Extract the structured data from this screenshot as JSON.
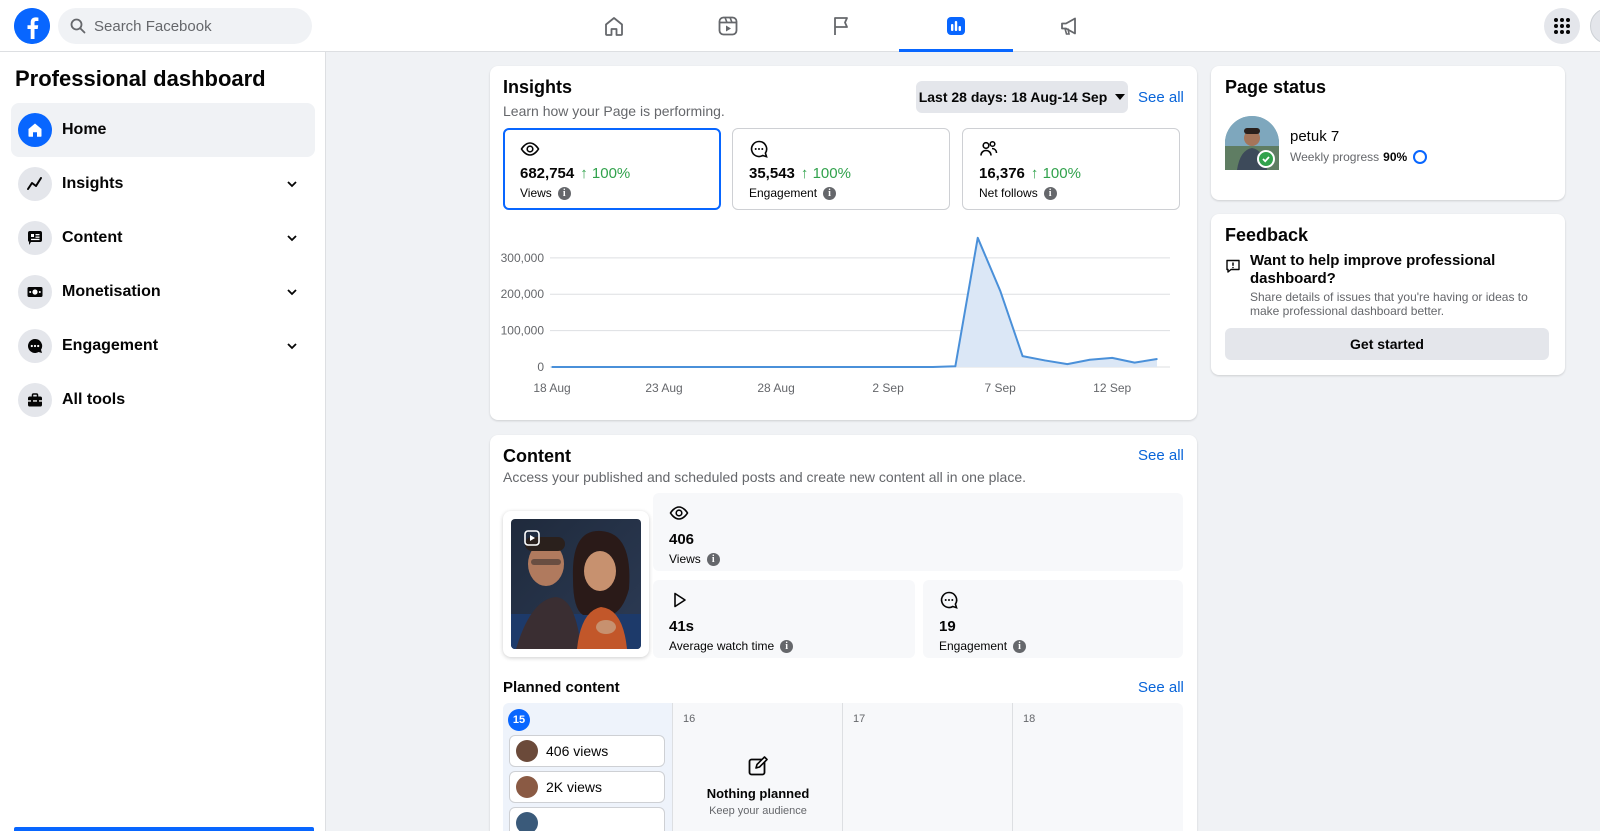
{
  "search": {
    "placeholder": "Search Facebook"
  },
  "nav": [
    "home-icon",
    "video-icon",
    "flag-icon",
    "insights-icon",
    "megaphone-icon"
  ],
  "sidebar": {
    "title": "Professional dashboard",
    "items": [
      {
        "label": "Home",
        "icon": "home-icon"
      },
      {
        "label": "Insights",
        "icon": "insights-icon"
      },
      {
        "label": "Content",
        "icon": "content-icon"
      },
      {
        "label": "Monetisation",
        "icon": "money-icon"
      },
      {
        "label": "Engagement",
        "icon": "engagement-icon"
      },
      {
        "label": "All tools",
        "icon": "toolbox-icon"
      }
    ]
  },
  "insights": {
    "title": "Insights",
    "subtitle": "Learn how your Page is performing.",
    "date_range": "Last 28 days: 18 Aug-14 Sep",
    "see_all": "See all",
    "metrics": [
      {
        "value": "682,754",
        "change": "100%",
        "label": "Views"
      },
      {
        "value": "35,543",
        "change": "100%",
        "label": "Engagement"
      },
      {
        "value": "16,376",
        "change": "100%",
        "label": "Net follows"
      }
    ]
  },
  "chart_data": {
    "type": "area",
    "title": "",
    "xlabel": "",
    "ylabel": "",
    "x": [
      "18 Aug",
      "19 Aug",
      "20 Aug",
      "21 Aug",
      "22 Aug",
      "23 Aug",
      "24 Aug",
      "25 Aug",
      "26 Aug",
      "27 Aug",
      "28 Aug",
      "29 Aug",
      "30 Aug",
      "31 Aug",
      "1 Sep",
      "2 Sep",
      "3 Sep",
      "4 Sep",
      "5 Sep",
      "6 Sep",
      "7 Sep",
      "8 Sep",
      "9 Sep",
      "10 Sep",
      "11 Sep",
      "12 Sep",
      "13 Sep",
      "14 Sep"
    ],
    "values": [
      0,
      0,
      0,
      0,
      0,
      0,
      0,
      0,
      0,
      0,
      0,
      0,
      0,
      0,
      0,
      0,
      0,
      0,
      2000,
      355000,
      210000,
      30000,
      18000,
      8000,
      20000,
      25000,
      12000,
      22000
    ],
    "x_ticks": [
      "18 Aug",
      "23 Aug",
      "28 Aug",
      "2 Sep",
      "7 Sep",
      "12 Sep"
    ],
    "y_ticks": [
      "0",
      "100,000",
      "200,000",
      "300,000"
    ],
    "ylim": [
      0,
      360000
    ],
    "grid": true,
    "color": "#4a90d9"
  },
  "content": {
    "title": "Content",
    "subtitle": "Access your published and scheduled posts and create new content all in one place.",
    "see_all": "See all",
    "views": {
      "value": "406",
      "label": "Views"
    },
    "watch": {
      "value": "41s",
      "label": "Average watch time"
    },
    "engagement": {
      "value": "19",
      "label": "Engagement"
    }
  },
  "planned": {
    "title": "Planned content",
    "see_all": "See all",
    "days": [
      "15",
      "16",
      "17",
      "18"
    ],
    "posts": [
      "406 views",
      "2K views"
    ],
    "nothing_title": "Nothing planned",
    "nothing_desc": "Keep your audience"
  },
  "page_status": {
    "title": "Page status",
    "name": "petuk 7",
    "progress_label": "Weekly progress",
    "progress": "90%"
  },
  "feedback": {
    "title": "Feedback",
    "question": "Want to help improve professional dashboard?",
    "desc": "Share details of issues that you're having or ideas to make professional dashboard better.",
    "button": "Get started"
  },
  "colors": {
    "accent": "#0866ff",
    "positive": "#31a24c",
    "link": "#0864d9"
  }
}
